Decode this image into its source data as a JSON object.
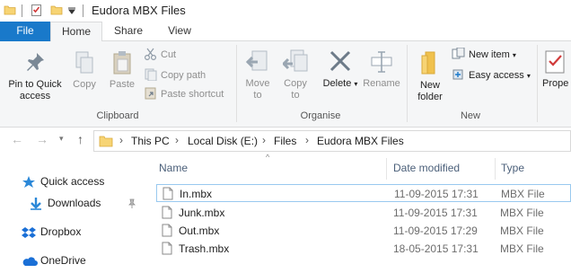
{
  "window": {
    "title": "Eudora MBX Files"
  },
  "ribbon_tabs": [
    "File",
    "Home",
    "Share",
    "View"
  ],
  "clipboard": {
    "pin_label_1": "Pin to Quick",
    "pin_label_2": "access",
    "copy": "Copy",
    "paste": "Paste",
    "cut": "Cut",
    "copy_path": "Copy path",
    "paste_shortcut": "Paste shortcut",
    "group": "Clipboard"
  },
  "organise": {
    "move_to_1": "Move",
    "move_to_2": "to",
    "copy_to_1": "Copy",
    "copy_to_2": "to",
    "delete": "Delete",
    "rename": "Rename",
    "group": "Organise"
  },
  "new": {
    "new_folder_1": "New",
    "new_folder_2": "folder",
    "new_item": "New item",
    "easy_access": "Easy access",
    "group": "New"
  },
  "open": {
    "properties": "Prope"
  },
  "address": {
    "crumbs": [
      "This PC",
      "Local Disk (E:)",
      "Files",
      "Eudora MBX Files"
    ]
  },
  "nav": {
    "items": [
      "Quick access",
      "Downloads",
      "Dropbox",
      "OneDrive"
    ]
  },
  "columns": {
    "name": "Name",
    "date": "Date modified",
    "type": "Type"
  },
  "files": [
    {
      "name": "In.mbx",
      "date": "11-09-2015 17:31",
      "type": "MBX File"
    },
    {
      "name": "Junk.mbx",
      "date": "11-09-2015 17:31",
      "type": "MBX File"
    },
    {
      "name": "Out.mbx",
      "date": "11-09-2015 17:29",
      "type": "MBX File"
    },
    {
      "name": "Trash.mbx",
      "date": "18-05-2015 17:31",
      "type": "MBX File"
    }
  ],
  "colors": {
    "accent": "#1979ca",
    "ribbon_bg": "#f5f6f7",
    "selection_border": "#99c9ef"
  }
}
